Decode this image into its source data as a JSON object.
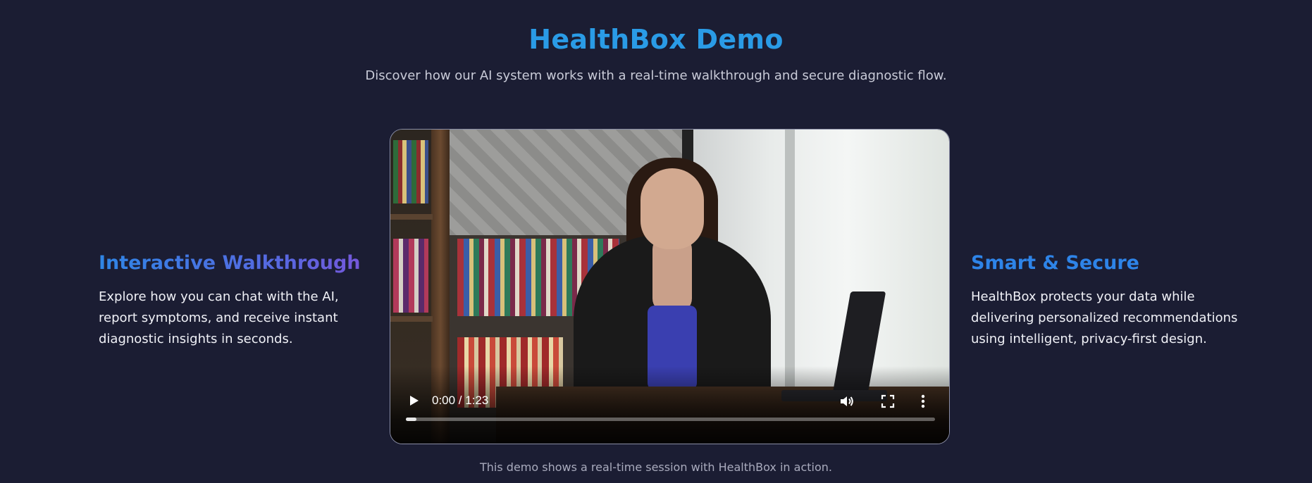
{
  "page": {
    "title": "HealthBox Demo",
    "subtitle": "Discover how our AI system works with a real-time walkthrough and secure diagnostic flow.",
    "caption": "This demo shows a real-time session with HealthBox in action."
  },
  "features": {
    "left": {
      "title": "Interactive Walkthrough",
      "body": "Explore how you can chat with the AI, report symptoms, and receive instant diagnostic insights in seconds."
    },
    "right": {
      "title": "Smart & Secure",
      "body": "HealthBox protects your data while delivering personalized recommendations using intelligent, privacy-first design."
    }
  },
  "video": {
    "time": "0:00 / 1:23",
    "progress_fraction": 0.02,
    "icons": [
      "play-icon",
      "volume-icon",
      "fullscreen-icon",
      "more-icon"
    ]
  },
  "colors": {
    "background": "#1b1d33",
    "title": "#2a9be6",
    "accent": "#2e84e8",
    "gradient_end": "#7a55d9"
  }
}
